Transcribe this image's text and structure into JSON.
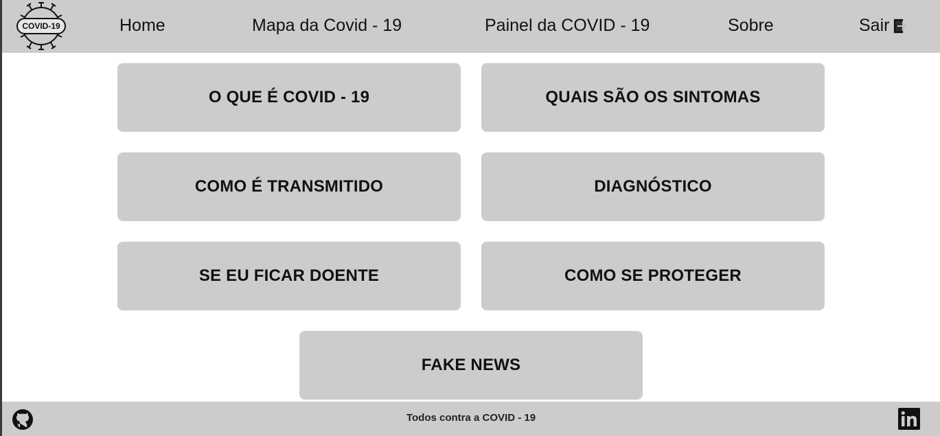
{
  "header": {
    "logo_text": "COVID-19",
    "nav": {
      "home": "Home",
      "mapa": "Mapa da Covid - 19",
      "painel": "Painel da COVID - 19",
      "sobre": "Sobre",
      "sair": "Sair"
    },
    "icons": {
      "logo": "covid-virus-logo",
      "exit": "exit-icon"
    }
  },
  "topics": {
    "o_que_e": "O QUE É COVID - 19",
    "sintomas": "QUAIS SÃO OS SINTOMAS",
    "transmitido": "COMO É TRANSMITIDO",
    "diagnostico": "DIAGNÓSTICO",
    "doente": "SE EU FICAR DOENTE",
    "proteger": "COMO SE PROTEGER",
    "fake_news": "FAKE NEWS"
  },
  "footer": {
    "text": "Todos contra a COVID - 19",
    "icons": {
      "left": "github-icon",
      "right": "linkedin-icon"
    }
  },
  "colors": {
    "bar_background": "#cccccc",
    "button_background": "#cccccc",
    "text": "#111111",
    "page_background": "#ffffff"
  }
}
